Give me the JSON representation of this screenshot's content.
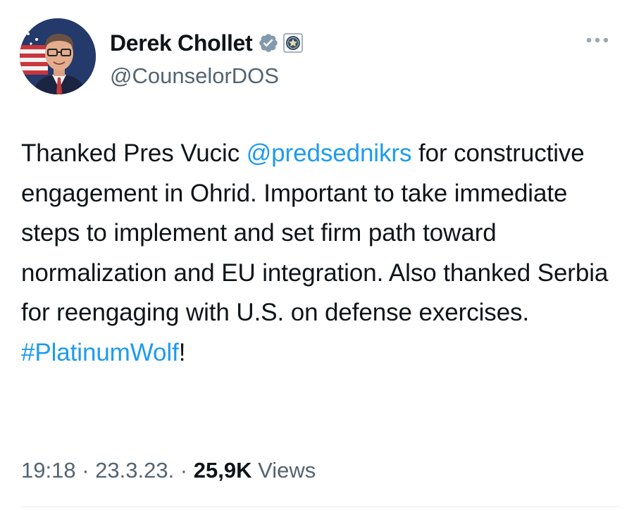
{
  "author": {
    "display_name": "Derek Chollet",
    "handle": "@CounselorDOS",
    "verified_badge_icon": "verified-badge-icon",
    "affiliation_icon": "state-department-seal-icon"
  },
  "tweet": {
    "text_parts": {
      "p1": "Thanked Pres Vucic ",
      "mention": "@predsednikrs",
      "p2": " for constructive engagement in Ohrid.  Important to take immediate steps to implement and set firm path toward normalization and EU integration. Also thanked Serbia for reengaging with U.S. on defense exercises. ",
      "hashtag": "#PlatinumWolf",
      "p3": "!"
    }
  },
  "meta": {
    "time": "19:18",
    "separator": " · ",
    "date": "23.3.23.",
    "views_count": "25,9K",
    "views_label": " Views"
  },
  "colors": {
    "link": "#1d9bf0",
    "text": "#0f1419",
    "secondary": "#536471"
  }
}
